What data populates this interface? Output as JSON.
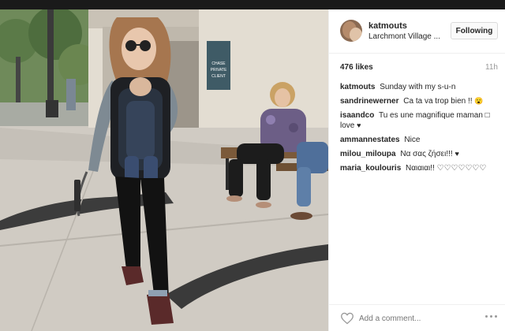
{
  "post": {
    "username": "katmouts",
    "location": "Larchmont Village ...",
    "follow_label": "Following",
    "likes": "476 likes",
    "time_ago": "11h",
    "photo_sign_text": "CHASE PRIVATE CLIENT",
    "comments": [
      {
        "user": "katmouts",
        "text": "Sunday with my s-u-n",
        "glyph": ""
      },
      {
        "user": "sandrinewerner",
        "text": "Ca ta va trop bien !!",
        "glyph": "😮"
      },
      {
        "user": "isaandco",
        "text": "Tu es une magnifique maman □ love",
        "glyph": "♥"
      },
      {
        "user": "ammannestates",
        "text": "Nice",
        "glyph": ""
      },
      {
        "user": "milou_miloupa",
        "text": "Να σας ζήσει!!!",
        "glyph": "♥"
      },
      {
        "user": "maria_koulouris",
        "text": "Ναιαιαι!! ♡♡♡♡♡♡♡",
        "glyph": ""
      }
    ],
    "add_comment_placeholder": "Add a comment..."
  },
  "icons": {
    "heart": "heart-outline-icon",
    "more": "more-options-icon"
  },
  "colors": {
    "border": "#efefef",
    "text": "#262626",
    "muted": "#999999"
  }
}
